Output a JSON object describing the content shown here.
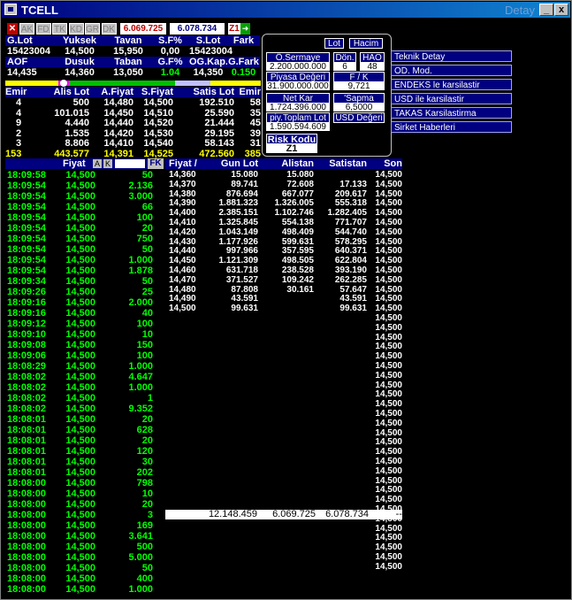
{
  "window": {
    "title": "TCELL",
    "title_right": "Detay",
    "min_label": "_",
    "close_label": "x"
  },
  "toolbar": {
    "buttons": [
      "AK",
      "FD",
      "TK",
      "KD",
      "GR",
      "DK"
    ],
    "value1": "6.069.725",
    "value2": "6.078.734",
    "tag": "Z1"
  },
  "summary": {
    "headers1": [
      "G.Lot",
      "Yuksek",
      "Tavan",
      "S.F%",
      "S.Lot",
      "Fark"
    ],
    "values1": [
      "15423004",
      "14,500",
      "15,950",
      "0,00",
      "15423004",
      ""
    ],
    "headers2": [
      "AOF",
      "Dusuk",
      "Taban",
      "G.F%",
      "OG.Kap.",
      "G.Fark"
    ],
    "values2": [
      "14,435",
      "14,360",
      "13,050",
      "1.04",
      "14,350",
      "0.150"
    ]
  },
  "depth": {
    "headers": [
      "Emir",
      "Alis Lot",
      "A.Fiyat",
      "S.Fiyat",
      "Satis Lot",
      "Emir"
    ],
    "rows": [
      [
        "4",
        "500",
        "14,480",
        "14,500",
        "192.510",
        "58"
      ],
      [
        "4",
        "101.015",
        "14,450",
        "14,510",
        "25.590",
        "35"
      ],
      [
        "9",
        "4.440",
        "14,440",
        "14,520",
        "21.444",
        "45"
      ],
      [
        "2",
        "1.535",
        "14,420",
        "14,530",
        "29.195",
        "39"
      ],
      [
        "3",
        "8.806",
        "14,410",
        "14,540",
        "58.143",
        "31"
      ]
    ],
    "totals": [
      "153",
      "443.577",
      "14,391",
      "14,525",
      "472.560",
      "385"
    ]
  },
  "panel": {
    "lot": "Lot",
    "hacim": "Hacim",
    "o_sermaye": "Ö.Sermaye",
    "o_sermaye_val": "2.200.000.000",
    "don": "Dön.",
    "don_val": "6",
    "hao": "HAO",
    "hao_val": "48",
    "piyasa": "Piyasa Değeri",
    "piyasa_val": "31.900.000.000",
    "fk": "F / K",
    "fk_val": "9,721",
    "netkar": "Net Kar",
    "netkar_val": "1.724.396.000",
    "sapma": "'Sapma",
    "sapma_val": "6,5000",
    "piytoplam": "piy.Toplam Lot",
    "piytoplam_val": "1.590.594.609",
    "usd": "USD Değeri",
    "risk": "Risk Kodu",
    "risk_val": "Z1"
  },
  "menu": [
    "Teknik Detay",
    "OD. Mod.",
    "ENDEKS le karsilastir",
    "USD ile karsilastir",
    "TAKAS Karsilastirma",
    "Sirket Haberleri"
  ],
  "trades": {
    "h_fiyat": "Fiyat",
    "h_a": "A",
    "h_k": "K",
    "h_fk": "FK",
    "rows": [
      [
        "18:09:58",
        "14,500",
        "50"
      ],
      [
        "18:09:54",
        "14,500",
        "2.136"
      ],
      [
        "18:09:54",
        "14,500",
        "3.000"
      ],
      [
        "18:09:54",
        "14,500",
        "66"
      ],
      [
        "18:09:54",
        "14,500",
        "100"
      ],
      [
        "18:09:54",
        "14,500",
        "20"
      ],
      [
        "18:09:54",
        "14,500",
        "750"
      ],
      [
        "18:09:54",
        "14,500",
        "50"
      ],
      [
        "18:09:54",
        "14,500",
        "1.000"
      ],
      [
        "18:09:54",
        "14,500",
        "1.878"
      ],
      [
        "18:09:34",
        "14,500",
        "50"
      ],
      [
        "18:09:26",
        "14,500",
        "25"
      ],
      [
        "18:09:16",
        "14,500",
        "2.000"
      ],
      [
        "18:09:16",
        "14,500",
        "40"
      ],
      [
        "18:09:12",
        "14,500",
        "100"
      ],
      [
        "18:09:10",
        "14,500",
        "10"
      ],
      [
        "18:09:08",
        "14,500",
        "150"
      ],
      [
        "18:09:06",
        "14,500",
        "100"
      ],
      [
        "18:08:29",
        "14,500",
        "1.000"
      ],
      [
        "18:08:02",
        "14,500",
        "4.647"
      ],
      [
        "18:08:02",
        "14,500",
        "1.000"
      ],
      [
        "18:08:02",
        "14,500",
        "1"
      ],
      [
        "18:08:02",
        "14,500",
        "9.352"
      ],
      [
        "18:08:01",
        "14,500",
        "20"
      ],
      [
        "18:08:01",
        "14,500",
        "628"
      ],
      [
        "18:08:01",
        "14,500",
        "20"
      ],
      [
        "18:08:01",
        "14,500",
        "120"
      ],
      [
        "18:08:01",
        "14,500",
        "30"
      ],
      [
        "18:08:01",
        "14,500",
        "202"
      ],
      [
        "18:08:00",
        "14,500",
        "798"
      ],
      [
        "18:08:00",
        "14,500",
        "10"
      ],
      [
        "18:08:00",
        "14,500",
        "20"
      ],
      [
        "18:08:00",
        "14,500",
        "3"
      ],
      [
        "18:08:00",
        "14,500",
        "169"
      ],
      [
        "18:08:00",
        "14,500",
        "3.641"
      ],
      [
        "18:08:00",
        "14,500",
        "500"
      ],
      [
        "18:08:00",
        "14,500",
        "5.000"
      ],
      [
        "18:08:00",
        "14,500",
        "50"
      ],
      [
        "18:08:00",
        "14,500",
        "400"
      ],
      [
        "18:08:00",
        "14,500",
        "1.000"
      ]
    ]
  },
  "dist": {
    "headers": [
      "Fiyat /",
      "Gun Lot",
      "Alistan",
      "Satistan",
      "Son"
    ],
    "rows": [
      [
        "14,360",
        "15.080",
        "15.080",
        "",
        "14,500"
      ],
      [
        "14,370",
        "89.741",
        "72.608",
        "17.133",
        "14,500"
      ],
      [
        "14,380",
        "876.694",
        "667.077",
        "209.617",
        "14,500"
      ],
      [
        "14,390",
        "1.881.323",
        "1.326.005",
        "555.318",
        "14,500"
      ],
      [
        "14,400",
        "2.385.151",
        "1.102.746",
        "1.282.405",
        "14,500"
      ],
      [
        "14,410",
        "1.325.845",
        "554.138",
        "771.707",
        "14,500"
      ],
      [
        "14,420",
        "1.043.149",
        "498.409",
        "544.740",
        "14,500"
      ],
      [
        "14,430",
        "1.177.926",
        "599.631",
        "578.295",
        "14,500"
      ],
      [
        "14,440",
        "997.966",
        "357.595",
        "640.371",
        "14,500"
      ],
      [
        "14,450",
        "1.121.309",
        "498.505",
        "622.804",
        "14,500"
      ],
      [
        "14,460",
        "631.718",
        "238.528",
        "393.190",
        "14,500"
      ],
      [
        "14,470",
        "371.527",
        "109.242",
        "262.285",
        "14,500"
      ],
      [
        "14,480",
        "87.808",
        "30.161",
        "57.647",
        "14,500"
      ],
      [
        "14,490",
        "43.591",
        "",
        "43.591",
        "14,500"
      ],
      [
        "14,500",
        "99.631",
        "",
        "99.631",
        "14,500"
      ]
    ],
    "son_extra": [
      "14,500",
      "14,500",
      "14,500",
      "14,500",
      "14,500",
      "14,500",
      "14,500",
      "14,500",
      "14,500",
      "14,500",
      "14,500",
      "14,500",
      "14,500",
      "14,500",
      "14,500",
      "14,500",
      "14,500",
      "14,500",
      "14,500",
      "14,500",
      "14,500",
      "14,500",
      "14,500",
      "14,500",
      "14,500",
      "14,500",
      "14,500"
    ],
    "totals": [
      "12.148.459",
      "6.069.725",
      "6.078.734",
      "--"
    ]
  },
  "colors": {
    "accent": "#000080",
    "buy": "#00ff00",
    "total": "#ffff00"
  }
}
